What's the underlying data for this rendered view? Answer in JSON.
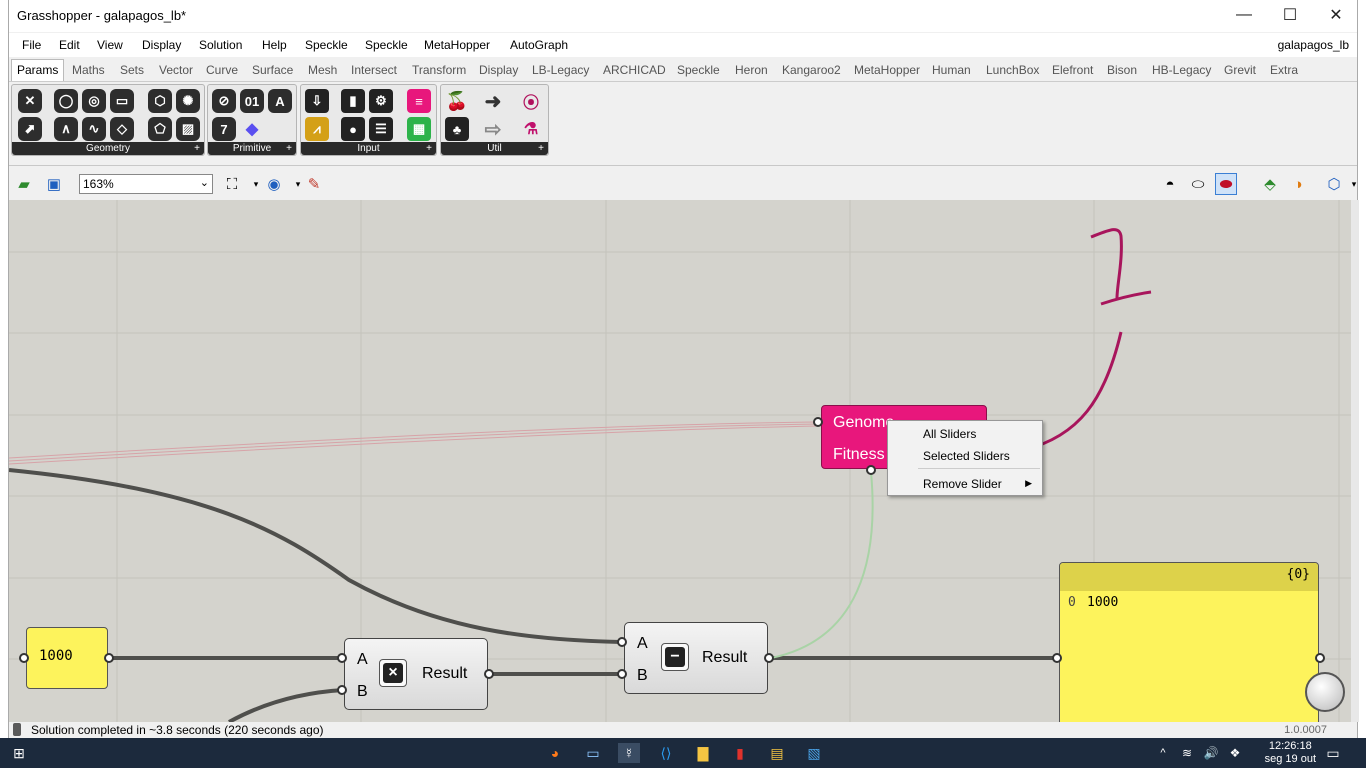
{
  "window": {
    "title": "Grasshopper - galapagos_lb*",
    "doc_name": "galapagos_lb"
  },
  "menu": [
    "File",
    "Edit",
    "View",
    "Display",
    "Solution",
    "Help",
    "Speckle",
    "Speckle",
    "MetaHopper",
    "AutoGraph"
  ],
  "tabs": [
    "Params",
    "Maths",
    "Sets",
    "Vector",
    "Curve",
    "Surface",
    "Mesh",
    "Intersect",
    "Transform",
    "Display",
    "LB-Legacy",
    "ARCHICAD",
    "Speckle",
    "Heron",
    "Kangaroo2",
    "MetaHopper",
    "Human",
    "LunchBox",
    "Elefront",
    "Bison",
    "HB-Legacy",
    "Grevit",
    "Extra"
  ],
  "active_tab": "Params",
  "ribbon_panels": [
    "Geometry",
    "Primitive",
    "Input",
    "Util"
  ],
  "toolbar": {
    "zoom": "163%"
  },
  "canvas": {
    "slider_value": "1000",
    "multiply_component": {
      "input_a": "A",
      "input_b": "B",
      "output": "Result",
      "icon": "×"
    },
    "subtract_component": {
      "input_a": "A",
      "input_b": "B",
      "output": "Result",
      "icon": "−"
    },
    "galapagos": {
      "genome_label": "Genome",
      "fitness_label": "Fitness"
    },
    "panel": {
      "header": "{0}",
      "index": "0",
      "value": "1000"
    },
    "annotation": "1"
  },
  "context_menu": [
    "All Sliders",
    "Selected Sliders",
    "Remove Slider"
  ],
  "status": {
    "message": "Solution completed in ~3.8 seconds (220 seconds ago)",
    "version": "1.0.0007"
  },
  "taskbar": {
    "time": "12:26:18",
    "date": "seg 19 out"
  },
  "colors": {
    "galapagos_pink": "#e8177c",
    "panel_yellow": "#fdf35c",
    "annotation": "#a8155c",
    "canvas": "#d4d3cd"
  }
}
